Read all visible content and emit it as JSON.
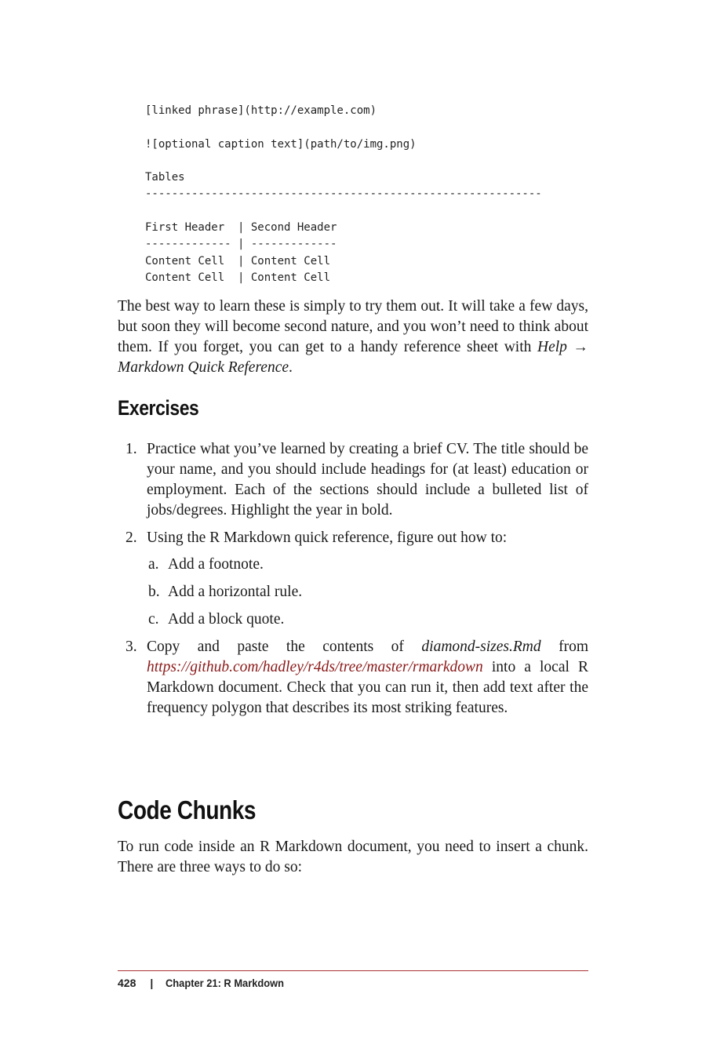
{
  "code_block": {
    "lines": [
      "[linked phrase](http://example.com)",
      "",
      "![optional caption text](path/to/img.png)",
      "",
      "Tables",
      "------------------------------------------------------------",
      "",
      "First Header  | Second Header",
      "------------- | -------------",
      "Content Cell  | Content Cell",
      "Content Cell  | Content Cell"
    ]
  },
  "intro_paragraph": {
    "text": "The best way to learn these is simply to try them out. It will take a few days, but soon they will become second nature, and you won’t need to think about them. If you forget, you can get to a handy reference sheet with ",
    "menu_path": "Help → Markdown Quick Reference",
    "end": "."
  },
  "exercises": {
    "heading": "Exercises",
    "items": [
      {
        "number": "1.",
        "text": "Practice what you’ve learned by creating a brief CV. The title should be your name, and you should include headings for (at least) education or employment. Each of the sections should include a bulleted list of jobs/degrees. Highlight the year in bold."
      },
      {
        "number": "2.",
        "text": "Using the R Markdown quick reference, figure out how to:",
        "subitems": [
          {
            "letter": "a.",
            "text": "Add a footnote."
          },
          {
            "letter": "b.",
            "text": "Add a horizontal rule."
          },
          {
            "letter": "c.",
            "text": "Add a block quote."
          }
        ]
      },
      {
        "number": "3.",
        "text_before": "Copy and paste the contents of ",
        "filename": "diamond-sizes.Rmd",
        "text_from": " from ",
        "link": "https://github.com/hadley/r4ds/tree/master/rmarkdown",
        "text_after": " into a local R Markdown document. Check that you can run it, then add text after the frequency polygon that describes its most striking features."
      }
    ]
  },
  "code_chunks": {
    "heading": "Code Chunks",
    "paragraph": "To run code inside an R Markdown document, you need to insert a chunk. There are three ways to do so:"
  },
  "footer": {
    "page_number": "428",
    "separator": "|",
    "chapter": "Chapter 21: R Markdown"
  },
  "colors": {
    "link": "#8b1a1a",
    "rule": "#aa3333"
  }
}
